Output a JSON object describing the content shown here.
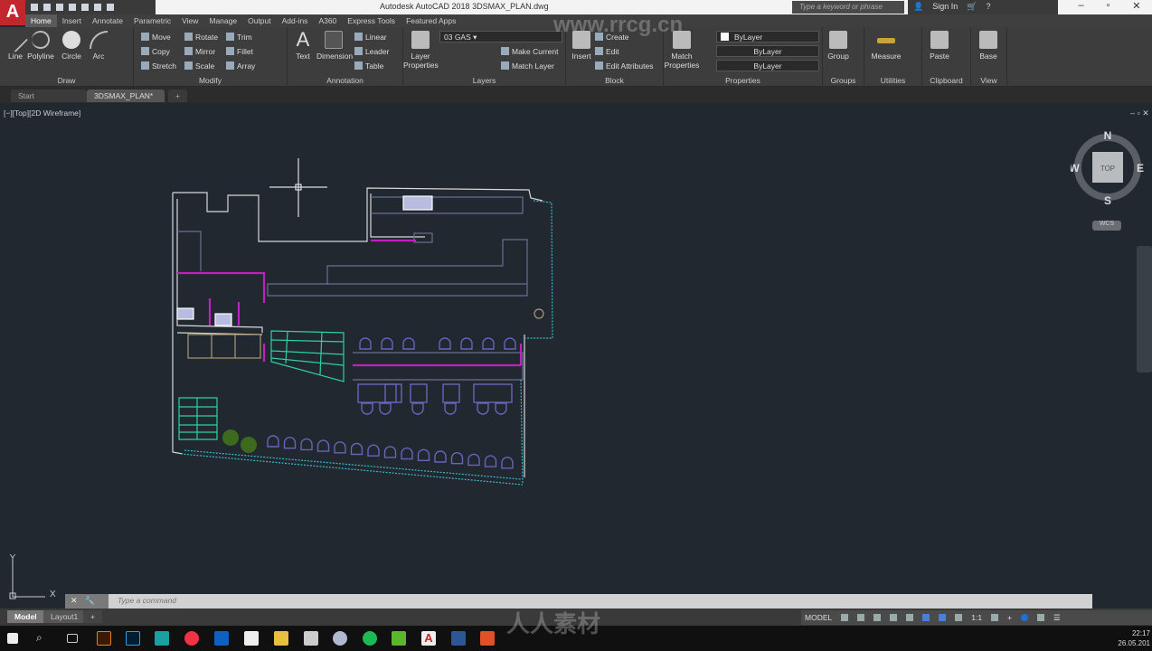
{
  "app": {
    "title": "Autodesk AutoCAD 2018    3DSMAX_PLAN.dwg",
    "logo": "A",
    "search_placeholder": "Type a keyword or phrase",
    "sign_in": "Sign In"
  },
  "tabs": [
    "Home",
    "Insert",
    "Annotate",
    "Parametric",
    "View",
    "Manage",
    "Output",
    "Add-ins",
    "A360",
    "Express Tools",
    "Featured Apps"
  ],
  "ribbon": {
    "draw": {
      "title": "Draw",
      "line": "Line",
      "polyline": "Polyline",
      "circle": "Circle",
      "arc": "Arc"
    },
    "modify": {
      "title": "Modify",
      "move": "Move",
      "rotate": "Rotate",
      "trim": "Trim",
      "copy": "Copy",
      "mirror": "Mirror",
      "fillet": "Fillet",
      "stretch": "Stretch",
      "scale": "Scale",
      "array": "Array"
    },
    "annotation": {
      "title": "Annotation",
      "text": "Text",
      "dimension": "Dimension",
      "linear": "Linear",
      "leader": "Leader",
      "table": "Table"
    },
    "layers": {
      "title": "Layers",
      "layer_properties": "Layer Properties",
      "current_layer": "03 GAS",
      "make_current": "Make Current",
      "match_layer": "Match Layer"
    },
    "block": {
      "title": "Block",
      "insert": "Insert",
      "create": "Create",
      "edit": "Edit",
      "edit_attributes": "Edit Attributes"
    },
    "properties": {
      "title": "Properties",
      "match_properties": "Match Properties",
      "color": "ByLayer",
      "linetype": "ByLayer",
      "lineweight": "ByLayer"
    },
    "groups": {
      "title": "Groups",
      "group": "Group"
    },
    "utilities": {
      "title": "Utilities",
      "measure": "Measure"
    },
    "clipboard": {
      "title": "Clipboard",
      "paste": "Paste"
    },
    "view": {
      "title": "View",
      "base": "Base"
    }
  },
  "file_tabs": [
    "Start",
    "3DSMAX_PLAN*"
  ],
  "viewport": {
    "label": "[−][Top][2D Wireframe]",
    "viewcube": {
      "top": "TOP",
      "n": "N",
      "s": "S",
      "e": "E",
      "w": "W",
      "wcs": "WCS"
    },
    "ucs": {
      "x": "X",
      "y": "Y"
    }
  },
  "command": {
    "placeholder": "Type a command"
  },
  "layout_tabs": [
    "Model",
    "Layout1"
  ],
  "status": {
    "model": "MODEL",
    "scale": "1:1"
  },
  "clock": {
    "time": "22:17",
    "date": "26.05.201"
  },
  "watermarks": [
    "www.rrcg.cn",
    "人人素材"
  ],
  "colors": {
    "viewport": "#212830",
    "walls": "#d8d8d8",
    "magenta": "#c020c0",
    "cyan": "#3ab8c8",
    "green": "#2fd0a0",
    "furniture": "#6a63b8"
  }
}
